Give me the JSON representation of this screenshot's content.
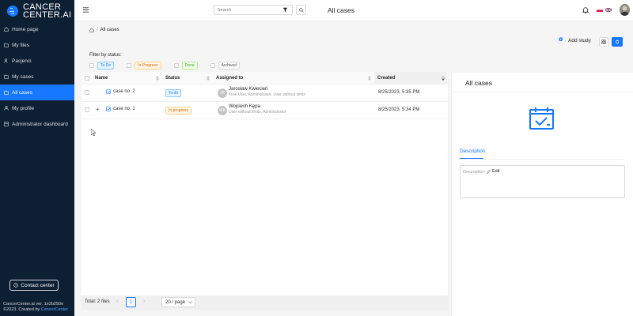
{
  "app": {
    "logo_line1": "CANCER",
    "logo_line2": "CENTER.AI",
    "version": "CancerCenter.ai ver. 1e2b250e",
    "copyright_prefix": "©2023. Created by ",
    "copyright_brand": "CancerCenter",
    "accent": "#1677ff",
    "sidebar_bg": "#0d1f33"
  },
  "sidebar": {
    "items": [
      {
        "label": "Home page",
        "icon": "home-icon"
      },
      {
        "label": "My files",
        "icon": "folder-icon"
      },
      {
        "label": "Pacjenci",
        "icon": "patients-icon"
      },
      {
        "label": "My cases",
        "icon": "folder-icon"
      },
      {
        "label": "All cases",
        "icon": "folder-icon",
        "active": true
      },
      {
        "label": "My profile",
        "icon": "user-icon"
      },
      {
        "label": "Administrator dashboard",
        "icon": "dashboard-icon"
      }
    ],
    "contact_label": "Contact center"
  },
  "topbar": {
    "search_placeholder": "Search",
    "title": "All cases"
  },
  "breadcrumb": {
    "current": "All cases"
  },
  "toolbar": {
    "add_study_label": "Add study"
  },
  "filters": {
    "label": "Filter by status:",
    "statuses": [
      "To Do",
      "In Progress",
      "Done",
      "Archived"
    ]
  },
  "table": {
    "columns": [
      "Name",
      "Status",
      "Assigned to",
      "Created"
    ],
    "rows": [
      {
        "name": "case no. 2",
        "status": "To do",
        "assignee_initials": "JK",
        "assignee_name": "Jarosław Kwiecień",
        "assignee_roles": "Free User, Administrator, User without limits",
        "created": "8/25/2023, 5:35 PM"
      },
      {
        "name": "case no. 1",
        "status": "In progress",
        "assignee_initials": "WK",
        "assignee_name": "Wojciech Kępa",
        "assignee_roles": "User without limits, Administrator",
        "created": "8/25/2023, 5:34 PM"
      }
    ]
  },
  "pagination": {
    "total": "Total: 2 files",
    "page": "1",
    "page_size": "20 / page"
  },
  "panel": {
    "title": "All cases",
    "tab": "Description",
    "desc_label": "Description",
    "edit_label": "Edit"
  }
}
